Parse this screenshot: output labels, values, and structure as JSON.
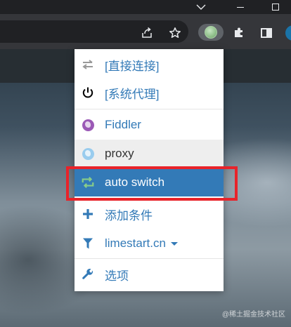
{
  "window": {
    "chevron": "⌄",
    "minimize": "",
    "maximize": ""
  },
  "toolbar": {
    "share_icon": "share-icon",
    "bookmark_icon": "☆",
    "extension_icon": "proxy-switch-extension-icon",
    "puzzle_icon": "puzzle-icon",
    "sidepanel_icon": "side-panel-icon"
  },
  "popup": {
    "items": [
      {
        "label": "[直接连接]",
        "icon": "direct-transfer-icon"
      },
      {
        "label": "[系统代理]",
        "icon": "power-icon"
      },
      {
        "label": "Fiddler",
        "icon": "globe-purple-icon"
      },
      {
        "label": "proxy",
        "icon": "globe-blue-icon"
      },
      {
        "label": "auto switch",
        "icon": "retweet-icon",
        "state": "selected"
      },
      {
        "label": "添加条件",
        "icon": "plus-icon"
      },
      {
        "label": "limestart.cn",
        "icon": "filter-icon"
      },
      {
        "label": "选项",
        "icon": "wrench-icon"
      }
    ]
  },
  "watermark": "@稀土掘金技术社区",
  "colors": {
    "accent": "#337ab7",
    "selected_bg": "#337ab7",
    "hover_bg": "#eeeeee",
    "annotation": "#e8232a",
    "fiddler_globe": "#9b59b6",
    "proxy_globe": "#99ccee",
    "autoswitch_icon": "#88cc88"
  }
}
